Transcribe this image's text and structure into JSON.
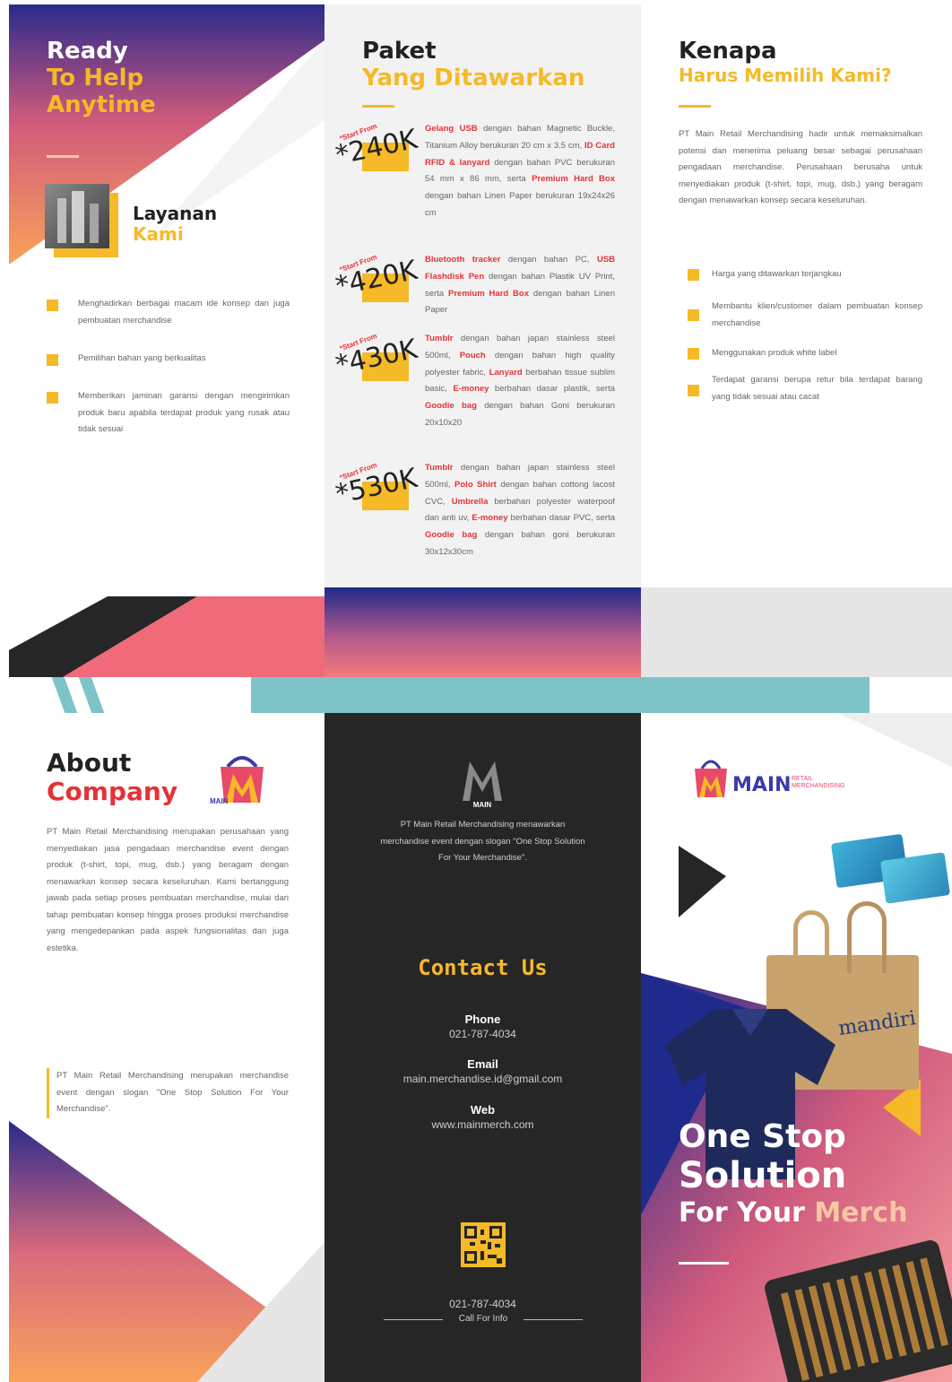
{
  "top": {
    "hero": {
      "line1": "Ready",
      "line2": "To Help",
      "line3": "Anytime"
    },
    "services": {
      "title": "Layanan",
      "subtitle": "Kami",
      "items": [
        "Menghadirkan berbagai macam ide konsep dan juga pembuatan merchandise",
        "Pemilihan bahan yang berkualitas",
        "Memberikan jaminan garansi dengan mengirimkan produk baru apabila terdapat produk yang rusak atau tidak sesuai"
      ]
    },
    "packages": {
      "title": "Paket",
      "subtitle": "Yang Ditawarkan",
      "start_from": "*Start From",
      "items": [
        {
          "price": "*240K",
          "parts": [
            {
              "t": "Gelang USB",
              "h": true
            },
            {
              "t": " dengan bahan Magnetic Buckle, Titanium Alloy berukuran 20 cm x 3.5 cm, ",
              "h": false
            },
            {
              "t": "ID Card RFID & lanyard",
              "h": true
            },
            {
              "t": " dengan bahan PVC berukuran 54 mm x 86 mm, serta ",
              "h": false
            },
            {
              "t": "Premium Hard Box",
              "h": true
            },
            {
              "t": " dengan bahan Linen Paper berukuran 19x24x26 cm",
              "h": false
            }
          ]
        },
        {
          "price": "*420K",
          "parts": [
            {
              "t": "Bluetooth tracker",
              "h": true
            },
            {
              "t": " dengan bahan PC, ",
              "h": false
            },
            {
              "t": "USB Flashdisk Pen",
              "h": true
            },
            {
              "t": " dengan bahan Plastik UV Print, serta ",
              "h": false
            },
            {
              "t": "Premium Hard Box",
              "h": true
            },
            {
              "t": " dengan bahan Linen Paper",
              "h": false
            }
          ]
        },
        {
          "price": "*430K",
          "parts": [
            {
              "t": "Tumblr",
              "h": true
            },
            {
              "t": " dengan bahan japan stainless steel 500ml, ",
              "h": false
            },
            {
              "t": "Pouch",
              "h": true
            },
            {
              "t": " dengan bahan high quality polyester fabric, ",
              "h": false
            },
            {
              "t": "Lanyard",
              "h": true
            },
            {
              "t": " berbahan tissue sublim basic, ",
              "h": false
            },
            {
              "t": "E-money",
              "h": true
            },
            {
              "t": " berbahan dasar plastik, serta ",
              "h": false
            },
            {
              "t": "Goodie bag",
              "h": true
            },
            {
              "t": " dengan bahan Goni berukuran 20x10x20",
              "h": false
            }
          ]
        },
        {
          "price": "*530K",
          "parts": [
            {
              "t": "Tumblr",
              "h": true
            },
            {
              "t": " dengan bahan japan stainless steel 500ml, ",
              "h": false
            },
            {
              "t": "Polo Shirt",
              "h": true
            },
            {
              "t": " dengan bahan cottong lacost CVC, ",
              "h": false
            },
            {
              "t": "Umbrella",
              "h": true
            },
            {
              "t": " berbahan polyester waterpoof dan anti uv, ",
              "h": false
            },
            {
              "t": "E-money",
              "h": true
            },
            {
              "t": " berbahan dasar PVC, serta ",
              "h": false
            },
            {
              "t": "Goodie bag",
              "h": true
            },
            {
              "t": " dengan bahan goni berukuran 30x12x30cm",
              "h": false
            }
          ]
        }
      ]
    },
    "why": {
      "title": "Kenapa",
      "subtitle": "Harus Memilih Kami?",
      "paragraph": "PT Main Retail Merchandising hadir untuk memaksimalkan potensi dan menerima peluang besar sebagai perusahaan pengadaan merchandise. Perusahaan berusaha untuk menyediakan produk (t-shirt, topi, mug, dsb.) yang beragam dengan menawarkan konsep secara keseluruhan.",
      "items": [
        "Harga yang ditawarkan terjangkau",
        "Membantu klien/customer dalam pembuatan konsep merchandise",
        "Menggunakan produk white label",
        "Terdapat garansi berupa retur bila terdapat barang yang tidak sesuai atau cacat"
      ]
    }
  },
  "bottom": {
    "about": {
      "title1": "About",
      "title2": "Company",
      "paragraph": "PT Main Retail Merchandising merupakan perusahaan yang menyediakan jasa pengadaan merchandise event dengan produk (t-shirt, topi, mug, dsb.) yang beragam dengan menawarkan konsep secara keseluruhan. Kami bertanggung jawab pada setiap proses pembuatan merchandise, mulai dari tahap pembuatan konsep hingga proses produksi merchandise yang mengedepankan pada aspek fungsionalitas dan juga estetika.",
      "quote": "PT Main Retail Merchandising merupakan merchandise event dengan slogan \"One Stop Solution For Your Merchandise\"."
    },
    "contact": {
      "logo_text": "MAIN",
      "intro": "PT Main Retail Merchandising menawarkan merchandise event dengan slogan \"One Stop Solution For Your Merchandise\".",
      "title": "Contact Us",
      "phone_label": "Phone",
      "phone": "021-787-4034",
      "email_label": "Email",
      "email": "main.merchandise.id@gmail.com",
      "web_label": "Web",
      "web": "www.mainmerch.com",
      "qr_number": "021-787-4034",
      "qr_caption": "Call For Info"
    },
    "cover": {
      "brand": "MAIN",
      "brand_sub1": "RETAIL",
      "brand_sub2": "MERCHANDISING",
      "line1": "One Stop",
      "line2": "Solution",
      "line3a": "For Your ",
      "line3b": "Merch",
      "bag_text": "mandiri"
    }
  }
}
